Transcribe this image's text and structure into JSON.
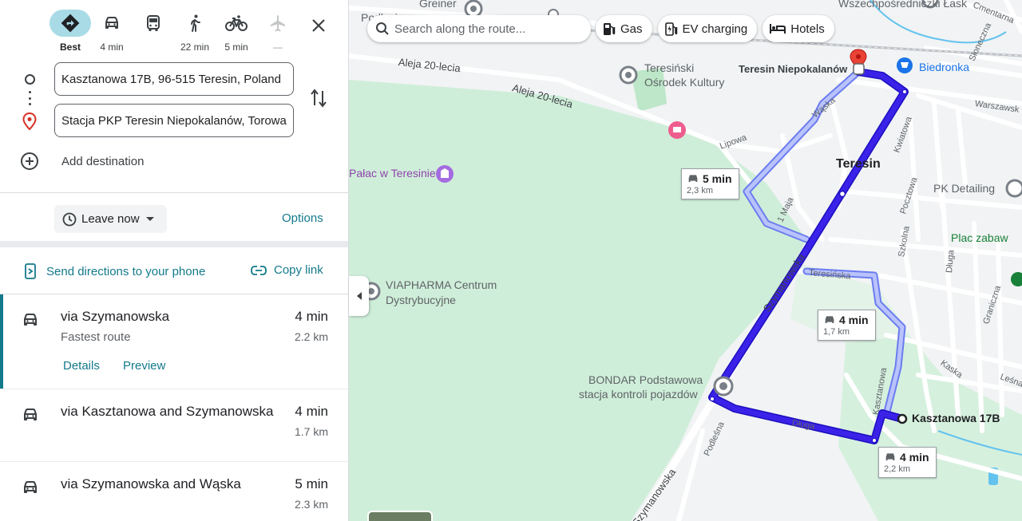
{
  "modes": [
    {
      "name": "best",
      "icon": "directions-diamond-icon",
      "label": "Best",
      "active": true
    },
    {
      "name": "car",
      "icon": "car-icon",
      "label": "4 min"
    },
    {
      "name": "transit",
      "icon": "bus-icon",
      "label": ""
    },
    {
      "name": "walk",
      "icon": "walk-icon",
      "label": "22 min"
    },
    {
      "name": "bike",
      "icon": "bike-icon",
      "label": "5 min"
    },
    {
      "name": "flight",
      "icon": "plane-icon",
      "label": "—",
      "disabled": true
    }
  ],
  "waypoints": {
    "origin": "Kasztanowa 17B, 96-515 Teresin, Poland",
    "destination": "Stacja PKP Teresin Niepokalanów, Torowa"
  },
  "add_destination": "Add destination",
  "leave_now": "Leave now",
  "options": "Options",
  "send_directions": "Send directions to your phone",
  "copy_link": "Copy link",
  "routes": [
    {
      "title": "via Szymanowska",
      "time": "4 min",
      "distance": "2.2 km",
      "subtitle": "Fastest route",
      "details": "Details",
      "preview": "Preview"
    },
    {
      "title": "via Kasztanowa and Szymanowska",
      "time": "4 min",
      "distance": "1.7 km"
    },
    {
      "title": "via Szymanowska and Wąska",
      "time": "5 min",
      "distance": "2.3 km"
    }
  ],
  "map": {
    "search_placeholder": "Search along the route...",
    "chips": [
      "Gas",
      "EV charging",
      "Hotels"
    ],
    "places": {
      "greiner": "Greiner",
      "podlasie": "Podlasie",
      "teresinski": "Teresiński",
      "osrodek": "Ośrodek Kultury",
      "teresin_station": "Teresin Niepokalanów",
      "biedronka": "Biedronka",
      "teresin": "Teresin",
      "palac": "Pałac w Teresinie",
      "pk_detailing": "PK Detailing",
      "plac_zabaw": "Plac zabaw",
      "viapharma_1": "VIAPHARMA Centrum",
      "viapharma_2": "Dystrybucyjne",
      "bondar_1": "BONDAR Podstawowa",
      "bondar_2": "stacja kontroli pojazdów",
      "kasztanowa_dest": "Kasztanowa 17B",
      "wszechpolski": "Wszechpośredniczki Łask"
    },
    "streets": {
      "aleja1": "Aleja 20-lecia",
      "aleja2": "Aleja 20-lecia",
      "lipowa": "Lipowa",
      "waska": "Wąska",
      "kwiatowa": "Kwiatowa",
      "pocztowa": "Pocztowa",
      "maja": "1 Maja",
      "szymanowska1": "Szymanowska",
      "szymanowska2": "Szymanowska",
      "teresinska": "Teresińska",
      "szkolna": "Szkolna",
      "dluga1": "Długa",
      "dluga2": "Długa",
      "kaska": "Kaska",
      "lesna": "Leśna",
      "kasztanowa": "Kasztanowa",
      "podlesna": "Podleśna",
      "graniczna": "Graniczna",
      "warszawska": "Warszawsk",
      "cmentarna": "Cmentarna",
      "sloneczna": "Słoneczna"
    },
    "bubbles": [
      {
        "time": "5 min",
        "distance": "2,3 km"
      },
      {
        "time": "4 min",
        "distance": "1,7 km"
      },
      {
        "time": "4 min",
        "distance": "2,2 km"
      }
    ]
  },
  "colors": {
    "accent": "#137a8b",
    "route_main": "#2c14e0",
    "route_alt": "#a9b4f5",
    "park": "#cfeed9",
    "urban": "#f1f3f4",
    "water": "#64c3ee"
  }
}
